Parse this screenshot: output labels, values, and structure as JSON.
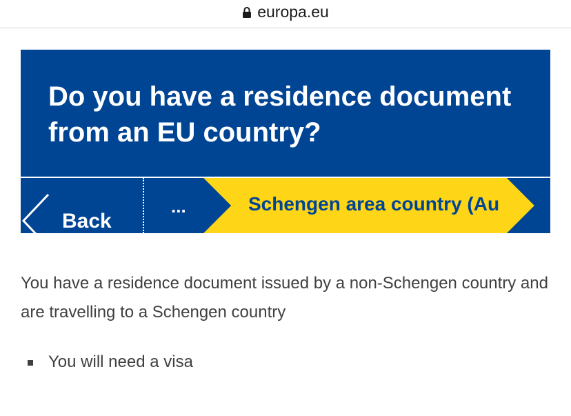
{
  "browser": {
    "domain": "europa.eu"
  },
  "header": {
    "title": "Do you have a residence document from an EU country?"
  },
  "stepbar": {
    "back_label": "Back",
    "ellipsis_label": "...",
    "current_step_label": "Schengen area country (Au"
  },
  "content": {
    "paragraph": "You have a residence document issued by a non-Schengen country and are travelling to a Schengen country",
    "bullets": [
      "You will need a visa"
    ]
  },
  "colors": {
    "eu_blue": "#004494",
    "eu_yellow": "#FFD617",
    "text": "#404040"
  }
}
